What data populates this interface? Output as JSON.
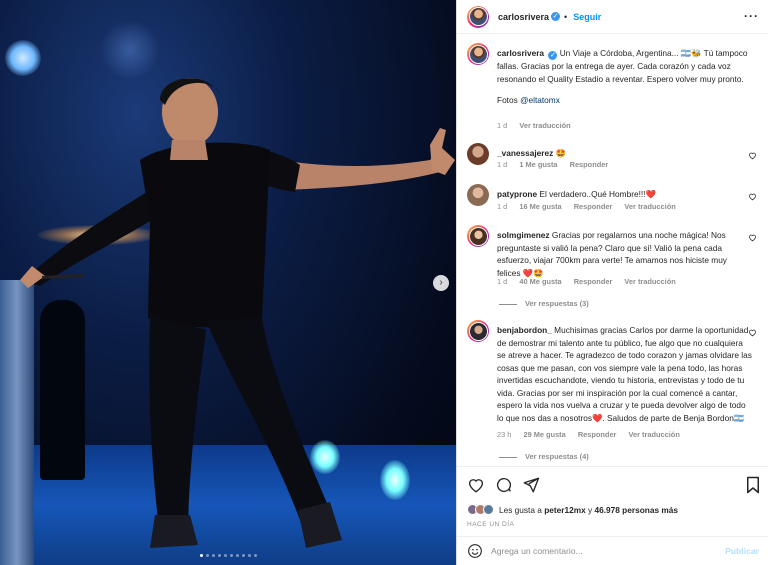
{
  "header": {
    "username": "carlosrivera",
    "separator": "•",
    "follow_label": "Seguir",
    "more_icon": "more-icon"
  },
  "caption": {
    "username": "carlosrivera",
    "text": "Un Viaje a Córdoba, Argentina... 🇦🇷🐝 Tú tampoco fallas. Gracias por la entrega de ayer. Cada corazón y cada voz resonando el Quality Estadio a reventar. Espero volver muy pronto.",
    "photos_prefix": "Fotos ",
    "photos_tag": "@eltatomx",
    "time": "1 d",
    "translate": "Ver traducción"
  },
  "comments": [
    {
      "username": "_vanessajerez",
      "text": "🤩",
      "time": "1 d",
      "likes": "1 Me gusta",
      "reply": "Responder",
      "translate": ""
    },
    {
      "username": "patyprone",
      "text": "El verdadero..Qué Hombre!!!❤️",
      "time": "1 d",
      "likes": "16 Me gusta",
      "reply": "Responder",
      "translate": "Ver traducción"
    },
    {
      "username": "solmgimenez",
      "text": "Gracias por regalarnos una noche mágica! Nos preguntaste si valió la pena? Claro que sí! Valió la pena cada esfuerzo, viajar 700km para verte! Te amamos nos hiciste muy felices ❤️🤩",
      "time": "1 d",
      "likes": "40 Me gusta",
      "reply": "Responder",
      "translate": "Ver traducción",
      "view_replies": "Ver respuestas (3)"
    },
    {
      "username": "benjabordon_",
      "text": "Muchisimas gracias Carlos por darme la oportunidad de demostrar mi talento ante tu público, fue algo que no cualquiera se atreve a hacer. Te agradezco de todo corazon y jamas olvidare las cosas que me pasan, con vos siempre vale la pena todo, las horas invertidas escuchandote, viendo tu historia, entrevistas y todo de tu vida. Gracias por ser mi inspiración por la cual comencé a cantar, espero la vida nos vuelva a cruzar y te pueda devolver algo de todo lo que nos das a nosotros❤️. Saludos de parte de Benja Bordon🇦🇷",
      "time": "23 h",
      "likes": "29 Me gusta",
      "reply": "Responder",
      "translate": "Ver traducción",
      "view_replies": "Ver respuestas (4)"
    }
  ],
  "actions": {
    "like_icon": "heart-icon",
    "comment_icon": "comment-icon",
    "share_icon": "share-icon",
    "save_icon": "bookmark-icon"
  },
  "likes": {
    "prefix": "Les gusta a ",
    "user": "peter12mx",
    "middle": " y ",
    "count": "46.978 personas más"
  },
  "posted": "HACE UN DÍA",
  "add_comment": {
    "placeholder": "Agrega un comentario...",
    "publish": "Publicar"
  },
  "carousel": {
    "slides": 10,
    "active_index": 0
  },
  "colors": {
    "link": "#0095f6",
    "verified": "#3897f0",
    "muted": "#8e8e8e",
    "like_heart": "#ed4956"
  }
}
